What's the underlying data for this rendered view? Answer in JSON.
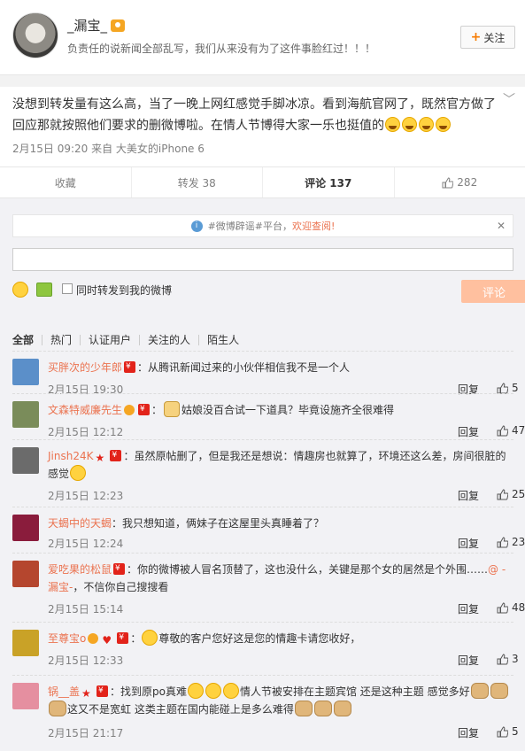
{
  "header": {
    "username": "_漏宝_",
    "bio": "负责任的说新闻全部乱写，我们从来没有为了这件事脸红过！！！",
    "follow_label": "关注"
  },
  "post": {
    "text": "没想到转发量有这么高，当了一晚上网红感觉手脚冰凉。看到海航官网了，既然官方做了回应那就按照他们要求的删微博啦。在情人节博得大家一乐也挺值的",
    "meta": "2月15日 09:20 来自 大美女的iPhone 6"
  },
  "actions": {
    "favorite": "收藏",
    "repost": "转发 38",
    "comment": "评论 137",
    "like": "282"
  },
  "notice": {
    "prefix": "#微博辟谣#平台，",
    "link": "欢迎查阅!"
  },
  "composer": {
    "checkbox_label": "同时转发到我的微博",
    "submit_label": "评论"
  },
  "filters": [
    "全部",
    "热门",
    "认证用户",
    "关注的人",
    "陌生人"
  ],
  "comments": [
    {
      "name": "买胖次的少年郎",
      "text": "：从腾讯新闻过来的小伙伴相信我不是一个人",
      "time": "2月15日 19:30",
      "reply": "回复",
      "likes": "5",
      "avatar_color": "#5b8fc9"
    },
    {
      "name": "文森特威廉先生",
      "text": "姑娘没百合试一下道具？毕竟设施齐全很难得",
      "time": "2月15日 12:12",
      "reply": "回复",
      "likes": "47",
      "avatar_color": "#7a8c5a"
    },
    {
      "name": "Jinsh24K",
      "text": "：虽然原帖删了，但是我还是想说：情趣房也就算了，环境还这么差，房间很脏的感觉",
      "time": "2月15日 12:23",
      "reply": "回复",
      "likes": "25",
      "avatar_color": "#6b6b6b"
    },
    {
      "name": "天蝎中的天蝎",
      "text": "：我只想知道，俩妹子在这屋里头真睡着了？",
      "time": "2月15日 12:24",
      "reply": "回复",
      "likes": "23",
      "avatar_color": "#8a1c3c"
    },
    {
      "name": "爱吃果的松鼠",
      "text": "：你的微博被人冒名顶替了，这也没什么，关键是那个女的居然是个外围……",
      "mention": "@ -漏宝-",
      "text2": "，不信你自己搜搜看",
      "time": "2月15日 15:14",
      "reply": "回复",
      "likes": "48",
      "avatar_color": "#b5462e"
    },
    {
      "name": "至尊宝o",
      "text": "尊敬的客户您好这是您的情趣卡请您收好，",
      "time": "2月15日 12:33",
      "reply": "回复",
      "likes": "3",
      "avatar_color": "#c9a227"
    },
    {
      "name": "锅__盖",
      "text": "：找到原po真难",
      "text2": "情人节被安排在主题宾馆 还是这种主题 感觉多好",
      "text3": "这又不是宽虹 这类主题在国内能碰上是多么难得",
      "time": "2月15日 21:17",
      "reply": "回复",
      "likes": "5",
      "avatar_color": "#e58fa0"
    }
  ],
  "colors": {
    "accent": "#eb7350",
    "muted": "#808080",
    "submit_bg": "#ffc09f"
  }
}
